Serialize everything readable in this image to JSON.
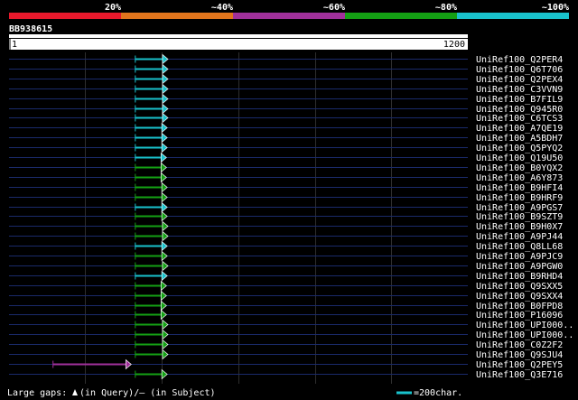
{
  "identity_legend": {
    "labels": [
      "20%",
      "~40%",
      "~60%",
      "~80%",
      "~100%"
    ],
    "colors": [
      "#e8192c",
      "#e2751c",
      "#a0309a",
      "#14a014",
      "#19c2cc"
    ]
  },
  "query": {
    "name": "BB938615",
    "length_start": "1",
    "length_end": "1200"
  },
  "hits": [
    {
      "name": "UniRef100_Q2PER4",
      "start": 331,
      "end": 414,
      "color": "cyan"
    },
    {
      "name": "UniRef100_Q6T706",
      "start": 331,
      "end": 414,
      "color": "cyan"
    },
    {
      "name": "UniRef100_Q2PEX4",
      "start": 331,
      "end": 414,
      "color": "cyan"
    },
    {
      "name": "UniRef100_C3VVN9",
      "start": 331,
      "end": 414,
      "color": "cyan"
    },
    {
      "name": "UniRef100_B7FIL9",
      "start": 331,
      "end": 414,
      "color": "cyan"
    },
    {
      "name": "UniRef100_Q945R0",
      "start": 331,
      "end": 414,
      "color": "cyan"
    },
    {
      "name": "UniRef100_C6TCS3",
      "start": 331,
      "end": 414,
      "color": "cyan"
    },
    {
      "name": "UniRef100_A7QE19",
      "start": 331,
      "end": 412,
      "color": "cyan"
    },
    {
      "name": "UniRef100_A5BDH7",
      "start": 331,
      "end": 412,
      "color": "cyan"
    },
    {
      "name": "UniRef100_Q5PYQ2",
      "start": 331,
      "end": 412,
      "color": "cyan"
    },
    {
      "name": "UniRef100_Q19U50",
      "start": 331,
      "end": 410,
      "color": "cyan"
    },
    {
      "name": "UniRef100_B0YQX2",
      "start": 331,
      "end": 410,
      "color": "green"
    },
    {
      "name": "UniRef100_A6Y873",
      "start": 331,
      "end": 410,
      "color": "green"
    },
    {
      "name": "UniRef100_B9HFI4",
      "start": 331,
      "end": 412,
      "color": "green"
    },
    {
      "name": "UniRef100_B9HRF9",
      "start": 331,
      "end": 412,
      "color": "green"
    },
    {
      "name": "UniRef100_A9PGS7",
      "start": 331,
      "end": 412,
      "color": "cyan"
    },
    {
      "name": "UniRef100_B9SZT9",
      "start": 331,
      "end": 412,
      "color": "green"
    },
    {
      "name": "UniRef100_B9H0X7",
      "start": 331,
      "end": 414,
      "color": "green"
    },
    {
      "name": "UniRef100_A9PJ44",
      "start": 331,
      "end": 414,
      "color": "green"
    },
    {
      "name": "UniRef100_Q8LL68",
      "start": 331,
      "end": 412,
      "color": "cyan"
    },
    {
      "name": "UniRef100_A9PJC9",
      "start": 331,
      "end": 412,
      "color": "green"
    },
    {
      "name": "UniRef100_A9PGW0",
      "start": 331,
      "end": 414,
      "color": "green"
    },
    {
      "name": "UniRef100_B9RHD4",
      "start": 331,
      "end": 412,
      "color": "cyan"
    },
    {
      "name": "UniRef100_Q9SXX5",
      "start": 331,
      "end": 410,
      "color": "green"
    },
    {
      "name": "UniRef100_Q9SXX4",
      "start": 331,
      "end": 410,
      "color": "green"
    },
    {
      "name": "UniRef100_B0FPD8",
      "start": 331,
      "end": 410,
      "color": "green"
    },
    {
      "name": "UniRef100_P16096",
      "start": 331,
      "end": 410,
      "color": "green"
    },
    {
      "name": "UniRef100_UPI000..",
      "start": 331,
      "end": 414,
      "color": "green"
    },
    {
      "name": "UniRef100_UPI000..",
      "start": 331,
      "end": 414,
      "color": "green"
    },
    {
      "name": "UniRef100_C0Z2F2",
      "start": 331,
      "end": 414,
      "color": "green"
    },
    {
      "name": "UniRef100_Q9SJU4",
      "start": 331,
      "end": 414,
      "color": "green"
    },
    {
      "name": "UniRef100_Q2PEY5",
      "start": 116,
      "end": 318,
      "color": "magenta"
    },
    {
      "name": "UniRef100_Q3E716",
      "start": 331,
      "end": 412,
      "color": "green"
    }
  ],
  "hit_colors": {
    "cyan": "#19c2cc",
    "green": "#14a014",
    "magenta": "#a0309a"
  },
  "footer": {
    "gaps_prefix": "Large gaps: ",
    "gaps_suffix": "(in Query)/– (in Subject)",
    "scale_label": "=200char."
  }
}
